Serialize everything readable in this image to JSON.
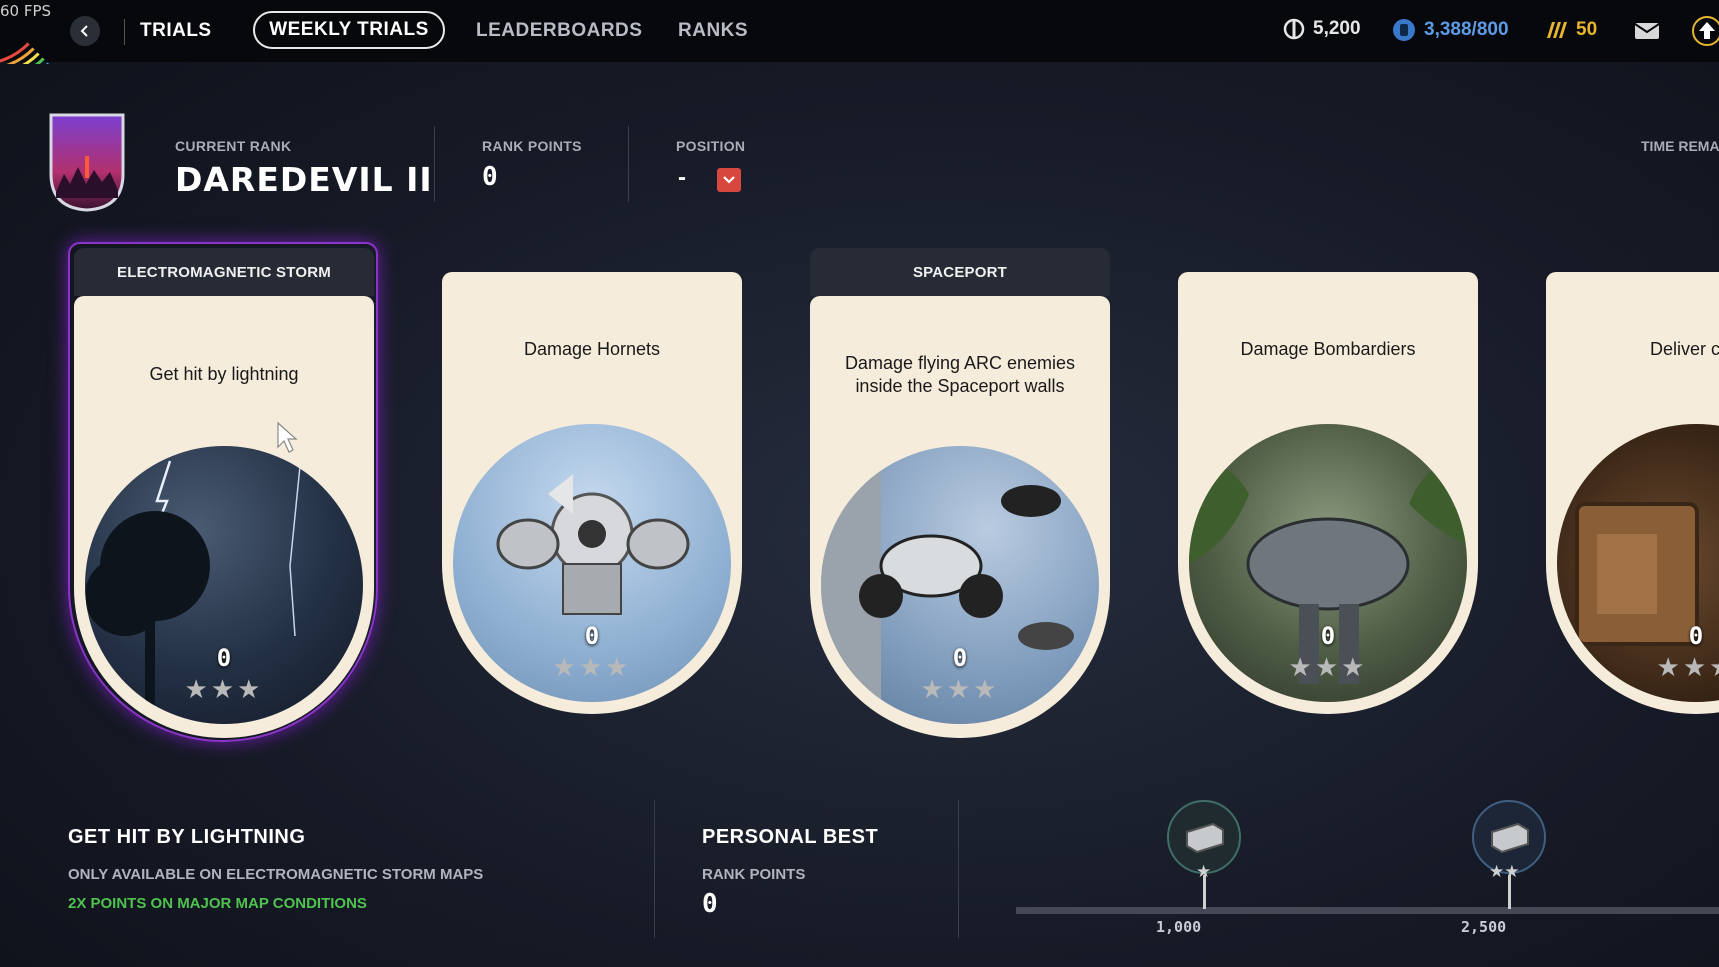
{
  "hud": {
    "fps": "60 FPS"
  },
  "nav": {
    "section": "TRIALS",
    "tabs": [
      "WEEKLY TRIALS",
      "LEADERBOARDS",
      "RANKS"
    ],
    "active_tab": "WEEKLY TRIALS"
  },
  "currencies": [
    {
      "icon": "coin-icon",
      "value": "5,200"
    },
    {
      "icon": "raider-token-icon",
      "value": "3,388/800"
    },
    {
      "icon": "credit-icon",
      "value": "50"
    }
  ],
  "rank": {
    "current_rank_label": "CURRENT RANK",
    "current_rank": "DAREDEVIL II",
    "rank_points_label": "RANK POINTS",
    "rank_points": "0",
    "position_label": "POSITION",
    "position": "-",
    "time_remaining_label": "TIME REMAI"
  },
  "trials": [
    {
      "header": "ELECTROMAGNETIC STORM",
      "task": "Get hit by lightning",
      "score": "0",
      "stars": 0,
      "selected": true,
      "image": "lightning-storm-image"
    },
    {
      "header": "",
      "task": "Damage Hornets",
      "score": "0",
      "stars": 0,
      "selected": false,
      "image": "hornet-drone-image"
    },
    {
      "header": "SPACEPORT",
      "task": "Damage flying ARC enemies inside the Spaceport walls",
      "score": "0",
      "stars": 0,
      "selected": false,
      "image": "arc-drones-image"
    },
    {
      "header": "",
      "task": "Damage Bombardiers",
      "score": "0",
      "stars": 0,
      "selected": false,
      "image": "bombardier-image"
    },
    {
      "header": "",
      "task": "Deliver carr",
      "score": "0",
      "stars": 0,
      "selected": false,
      "image": "cargo-crate-image"
    }
  ],
  "details": {
    "title": "GET HIT BY LIGHTNING",
    "availability": "ONLY AVAILABLE ON ELECTROMAGNETIC STORM MAPS",
    "bonus": "2X POINTS ON MAJOR MAP CONDITIONS"
  },
  "personal_best": {
    "title": "PERSONAL BEST",
    "label": "RANK POINTS",
    "value": "0"
  },
  "milestones": [
    {
      "points": "1,000",
      "stars": 1,
      "reward_icon": "crate-reward-icon"
    },
    {
      "points": "2,500",
      "stars": 2,
      "reward_icon": "crate-reward-icon"
    }
  ],
  "colors": {
    "accent_red": "#d7473d",
    "bonus_green": "#4fc24f",
    "card_cream": "#f6ecdc",
    "selected_purple": "#8a34c9",
    "token_blue": "#5d9be6",
    "credit_gold": "#e7b52f"
  }
}
